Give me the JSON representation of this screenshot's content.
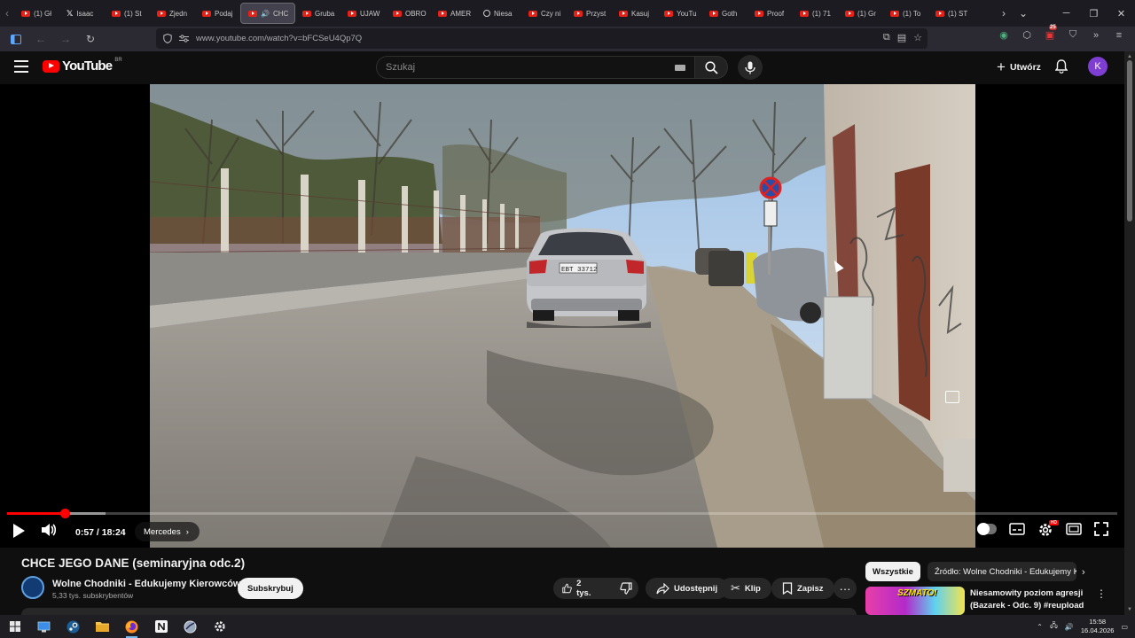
{
  "browser": {
    "tabs": [
      {
        "label": "(1) Gł",
        "icon": "youtube"
      },
      {
        "label": "Isaac",
        "icon": "x"
      },
      {
        "label": "(1) St",
        "icon": "youtube"
      },
      {
        "label": "Zjedn",
        "icon": "youtube"
      },
      {
        "label": "Podaj",
        "icon": "youtube"
      },
      {
        "label": "CHC",
        "icon": "youtube",
        "active": true
      },
      {
        "label": "Gruba",
        "icon": "youtube"
      },
      {
        "label": "UJAW",
        "icon": "youtube"
      },
      {
        "label": "OBRO",
        "icon": "youtube"
      },
      {
        "label": "AMER",
        "icon": "youtube"
      },
      {
        "label": "Niesa",
        "icon": "generic"
      },
      {
        "label": "Czy ni",
        "icon": "youtube"
      },
      {
        "label": "Przyst",
        "icon": "youtube"
      },
      {
        "label": "Kasuj",
        "icon": "youtube"
      },
      {
        "label": "YouTu",
        "icon": "youtube"
      },
      {
        "label": "Goth",
        "icon": "youtube"
      },
      {
        "label": "Proof",
        "icon": "youtube"
      },
      {
        "label": "(1) 71",
        "icon": "youtube"
      },
      {
        "label": "(1) Gr",
        "icon": "youtube"
      },
      {
        "label": "(1) To",
        "icon": "youtube"
      },
      {
        "label": "(1) ST",
        "icon": "youtube"
      }
    ],
    "url": "www.youtube.com/watch?v=bFCSeU4Qp7Q",
    "extension_badge": "25"
  },
  "youtube": {
    "logo_text": "YouTube",
    "country_code": "BR",
    "search_placeholder": "Szukaj",
    "create_label": "Utwórz",
    "avatar_letter": "K"
  },
  "player": {
    "progress_fraction": 0.0522,
    "buffered_fraction": 0.089,
    "current_time": "0:57",
    "duration": "18:24",
    "time_display": "0:57 / 18:24",
    "chapter": "Mercedes",
    "plate_text": "EBT 33712"
  },
  "video": {
    "title": "CHCE JEGO DANE (seminaryjna odc.2)",
    "channel": "Wolne Chodniki - Edukujemy Kierowców",
    "subscribers": "5,33 tys. subskrybentów",
    "subscribe_label": "Subskrybuj",
    "likes": "2 tys.",
    "share_label": "Udostępnij",
    "clip_label": "Klip",
    "save_label": "Zapisz"
  },
  "sidebar": {
    "chips": [
      "Wszystkie",
      "Źródło: Wolne Chodniki - Edukujemy K"
    ],
    "recommendation": {
      "title": "Niesamowity poziom agresji (Bazarek - Odc. 9) #reupload",
      "thumb_text": "SZMATO!"
    }
  },
  "taskbar": {
    "time": "15:58",
    "date": "16.04.2026"
  },
  "colors": {
    "accent_red": "#ff0000",
    "background": "#0f0f0f",
    "avatar": "#7e3ed1"
  }
}
